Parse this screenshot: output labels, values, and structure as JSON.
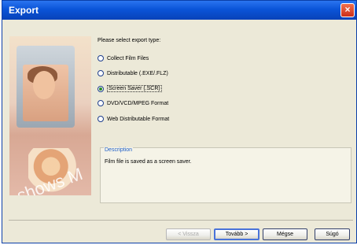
{
  "window": {
    "title": "Export",
    "close_icon": "×"
  },
  "prompt": "Please select export type:",
  "options": [
    {
      "label": "Collect Film Files",
      "selected": false
    },
    {
      "label": "Distributable (.EXE/.FLZ)",
      "selected": false
    },
    {
      "label": "Screen Saver (.SCR)",
      "selected": true
    },
    {
      "label": "DVD/VCD/MPEG Format",
      "selected": false
    },
    {
      "label": "Web Distributable Format",
      "selected": false
    }
  ],
  "description": {
    "title": "Description",
    "text": "Film file is saved as a screen saver."
  },
  "watermark": "shows M",
  "buttons": {
    "back": "< Vissza",
    "next": "Tovább >",
    "cancel": "Mégse",
    "help": "Súgó"
  }
}
